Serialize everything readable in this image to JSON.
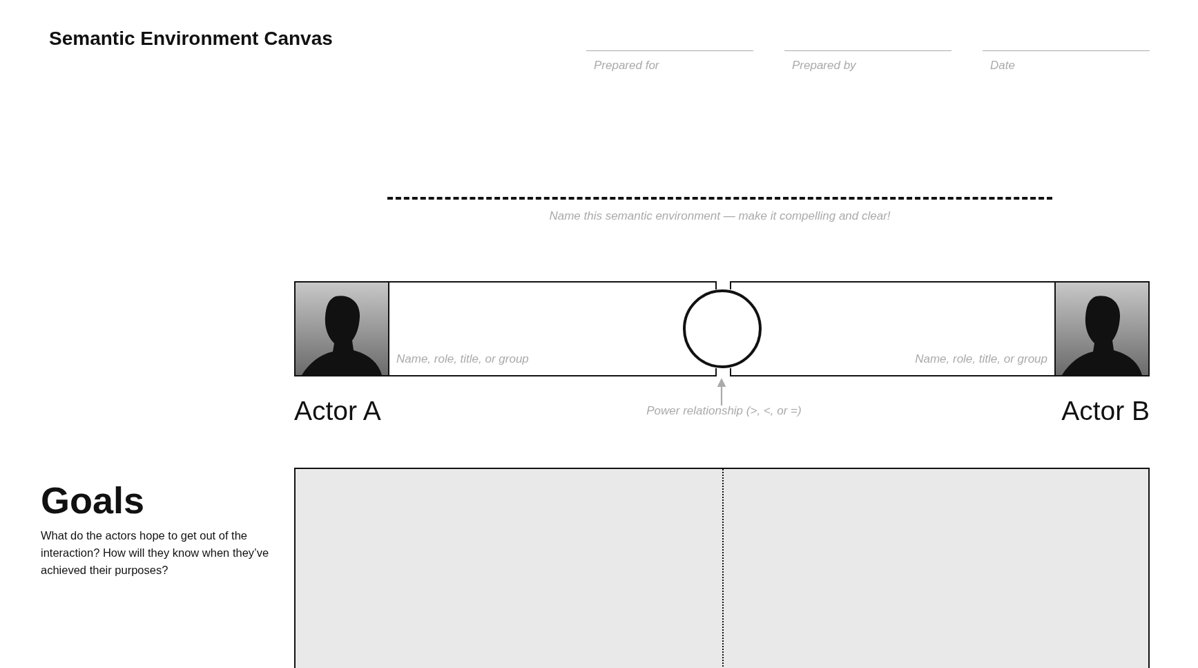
{
  "title": "Semantic Environment Canvas",
  "header_fields": [
    {
      "label": "Prepared for"
    },
    {
      "label": "Prepared by"
    },
    {
      "label": "Date"
    }
  ],
  "environment_name": {
    "label": "Name this semantic environment — make it compelling and clear!"
  },
  "actors": [
    {
      "label": "Actor A",
      "placeholder": "Name, role, title, or group"
    },
    {
      "label": "Actor B",
      "placeholder": "Name, role, title, or group"
    }
  ],
  "power_relationship": {
    "caption": "Power relationship (>, <, or =)"
  },
  "sections": [
    {
      "heading": "Goals",
      "description": "What do the actors hope to get out of the interaction? How will they know when they’ve achieved their purposes?"
    }
  ]
}
